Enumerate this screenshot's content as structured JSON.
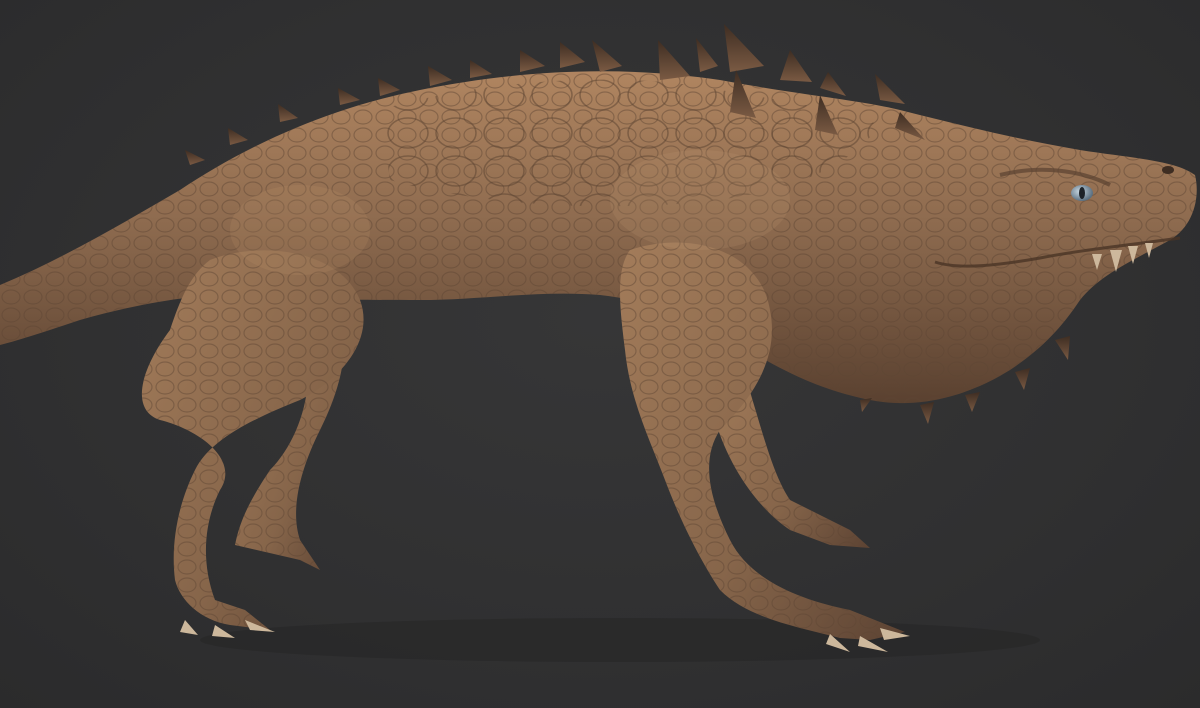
{
  "viewport": {
    "background_color": "#303031",
    "subject": "creature-sculpt"
  },
  "model": {
    "material_color": "#8a6a4e",
    "highlight_color": "#b58a62",
    "shadow_color": "#4a3526",
    "eye_color": "#9bb2c2",
    "spike_color": "#5e4534"
  }
}
